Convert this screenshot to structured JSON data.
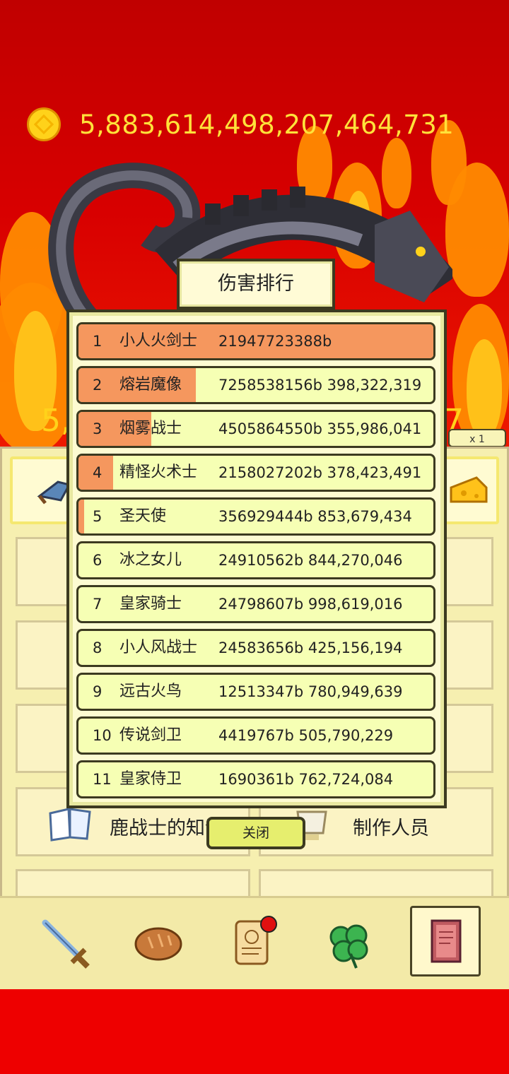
{
  "currency": {
    "icon": "gold-coin-icon",
    "value": "5,883,614,498,207,464,731"
  },
  "partial_numbers": {
    "left": "5,",
    "right": "7"
  },
  "speed_button": "x 1",
  "ranking": {
    "title": "伤害排行",
    "rows": [
      {
        "rank": "1",
        "name": "小人火剑士",
        "damage": "21947723388b",
        "fill": 1.0
      },
      {
        "rank": "2",
        "name": "熔岩魔像",
        "damage": "7258538156b 398,322,319",
        "fill": 0.33
      },
      {
        "rank": "3",
        "name": "烟雾战士",
        "damage": "4505864550b 355,986,041",
        "fill": 0.205
      },
      {
        "rank": "4",
        "name": "精怪火术士",
        "damage": "2158027202b 378,423,491",
        "fill": 0.098
      },
      {
        "rank": "5",
        "name": "圣天使",
        "damage": "356929444b 853,679,434",
        "fill": 0.016
      },
      {
        "rank": "6",
        "name": "冰之女儿",
        "damage": "24910562b 844,270,046",
        "fill": 0
      },
      {
        "rank": "7",
        "name": "皇家骑士",
        "damage": "24798607b 998,619,016",
        "fill": 0
      },
      {
        "rank": "8",
        "name": "小人风战士",
        "damage": "24583656b 425,156,194",
        "fill": 0
      },
      {
        "rank": "9",
        "name": "远古火鸟",
        "damage": "12513347b 780,949,639",
        "fill": 0
      },
      {
        "rank": "10",
        "name": "传说剑卫",
        "damage": "4419767b 505,790,229",
        "fill": 0
      },
      {
        "rank": "11",
        "name": "皇家侍卫",
        "damage": "1690361b 762,724,084",
        "fill": 0
      }
    ],
    "close_label": "关闭"
  },
  "menu": {
    "knowledge_label": "鹿战士的知识",
    "credits_label": "制作人员"
  },
  "nav": [
    {
      "name": "sword-icon"
    },
    {
      "name": "bread-icon"
    },
    {
      "name": "scroll-icon",
      "badge": true
    },
    {
      "name": "clover-icon"
    },
    {
      "name": "book-icon",
      "selected": true
    }
  ],
  "colors": {
    "bar_fill": "#f5975e",
    "row_bg": "#f6ffb4",
    "coin_text": "#ffe23a"
  }
}
